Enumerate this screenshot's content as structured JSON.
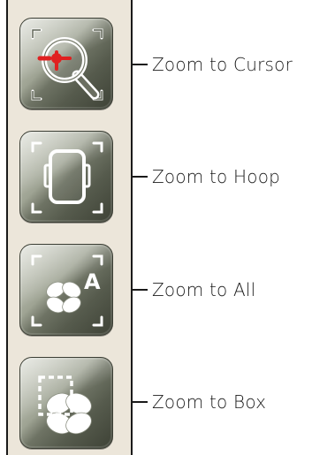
{
  "toolbar": {
    "buttons": [
      {
        "id": "zoom-to-cursor",
        "icon": "zoom-to-cursor-icon",
        "label": "Zoom to Cursor"
      },
      {
        "id": "zoom-to-hoop",
        "icon": "zoom-to-hoop-icon",
        "label": "Zoom to Hoop"
      },
      {
        "id": "zoom-to-all",
        "icon": "zoom-to-all-icon",
        "label": "Zoom to All"
      },
      {
        "id": "zoom-to-box",
        "icon": "zoom-to-box-icon",
        "label": "Zoom to Box"
      }
    ],
    "all_icon_letter": "A"
  },
  "colors": {
    "panel_background": "#ece6da",
    "button_gradient_light": "#cfd2c6",
    "button_gradient_dark": "#3e4236",
    "icon_outline": "#ffffff",
    "cursor_accent": "#e02020",
    "text": "#1a1a1a"
  }
}
